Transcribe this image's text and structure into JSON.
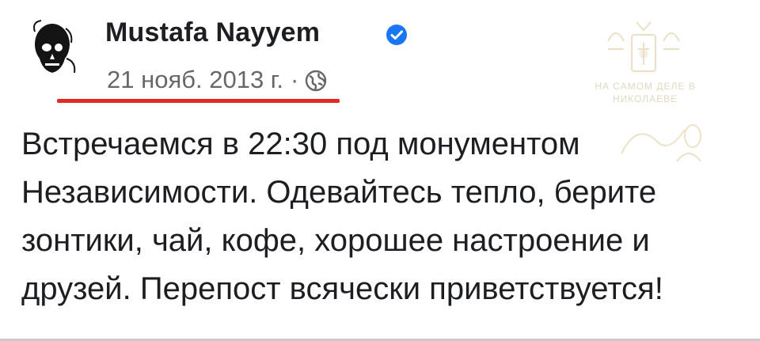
{
  "post": {
    "author_name": "Mustafa Nayyem",
    "date": "21 нояб. 2013 г.",
    "separator": "·",
    "body_lines": [
      "Встречаемся в 22:30 под монументом",
      "Независимости. Одевайтесь тепло, берите",
      "зонтики, чай, кофе, хорошее настроение и",
      "друзей. Перепост всячески приветствуется!"
    ]
  },
  "watermark": {
    "line1": "НА САМОМ ДЕЛЕ В",
    "line2": "НИКОЛАЕВЕ"
  },
  "icons": {
    "avatar": "skull-portrait-avatar",
    "verified": "verified-badge-icon",
    "audience": "globe-icon"
  },
  "colors": {
    "verified_badge": "#1877f2",
    "meta_text": "#65676b",
    "body_text": "#1c1e21",
    "annotation_underline": "#e12a22"
  }
}
